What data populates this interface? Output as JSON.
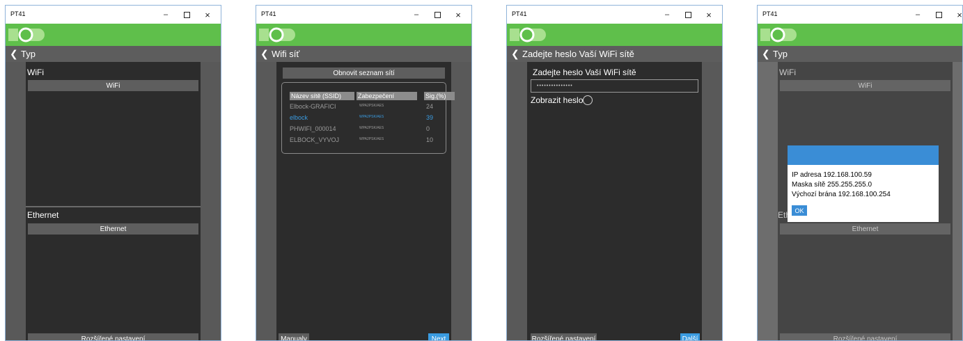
{
  "windows": [
    {
      "title": "PT41",
      "nav_title": "Typ",
      "wifi_label": "WiFi",
      "wifi_button": "WiFi",
      "ethernet_label": "Ethernet",
      "ethernet_button": "Ethernet",
      "advanced_button": "Rozšířené nastavení"
    },
    {
      "title": "PT41",
      "nav_title": "Wifi síť",
      "refresh_button": "Obnovit seznam sítí",
      "columns": [
        "Název sítě (SSID)",
        "Zabezpečení",
        "Sig.(%)"
      ],
      "networks": [
        {
          "ssid": "Elbock-GRAFICI",
          "security": "WPA2PSK/AES",
          "signal": "24",
          "selected": false
        },
        {
          "ssid": "elbock",
          "security": "WPA2PSK/AES",
          "signal": "39",
          "selected": true
        },
        {
          "ssid": "PHWIFI_000014",
          "security": "WPA2PSK/AES",
          "signal": "0",
          "selected": false
        },
        {
          "ssid": "ELBOCK_VYVOJ",
          "security": "WPA2PSK/AES",
          "signal": "10",
          "selected": false
        }
      ],
      "manual_button": "Manualy",
      "next_button": "Next"
    },
    {
      "title": "PT41",
      "nav_title": "Zadejte heslo Vaší WiFi sítě",
      "prompt": "Zadejte heslo Vaší WiFi sítě",
      "password_value": "•••••••••••••••",
      "show_password": "Zobrazit heslo",
      "advanced_button": "Rozšířené nastavení",
      "next_button": "Další"
    },
    {
      "title": "PT41",
      "nav_title": "Typ",
      "wifi_label": "WiFi",
      "wifi_button": "WiFi",
      "ethernet_label": "Eth",
      "ethernet_button": "Ethernet",
      "advanced_button": "Rozšířené nastavení",
      "dialog": {
        "ip": "IP adresa 192.168.100.59",
        "mask": "Maska sítě 255.255.255.0",
        "gateway": "Výchozí brána 192.168.100.254",
        "ok": "OK"
      }
    }
  ],
  "window_controls": {
    "minimize": "–",
    "close": "×"
  },
  "colors": {
    "accent_green": "#5fbf4b",
    "accent_blue": "#3a9be0",
    "panel": "#2c2c2c"
  }
}
